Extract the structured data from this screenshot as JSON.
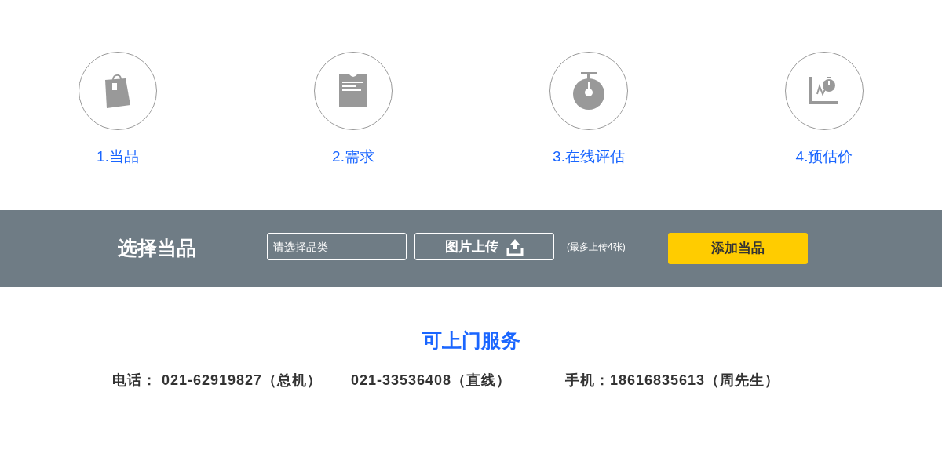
{
  "steps": [
    {
      "kind": "bag",
      "label": "1.当品"
    },
    {
      "kind": "clipboard",
      "label": "2.需求"
    },
    {
      "kind": "stopwatch",
      "label": "3.在线评估"
    },
    {
      "kind": "chart",
      "label": "4.预估价"
    }
  ],
  "bar": {
    "title": "选择当品",
    "category_field": {
      "placeholder": "请选择品类"
    },
    "upload_button": "图片上传",
    "upload_note": "(最多上传4张)",
    "add_button": "添加当品"
  },
  "service": {
    "title": "可上门服务",
    "contacts": [
      "电话： 021-62919827（总机）",
      "021-33536408（直线）",
      "手机：18616835613（周先生）"
    ]
  }
}
